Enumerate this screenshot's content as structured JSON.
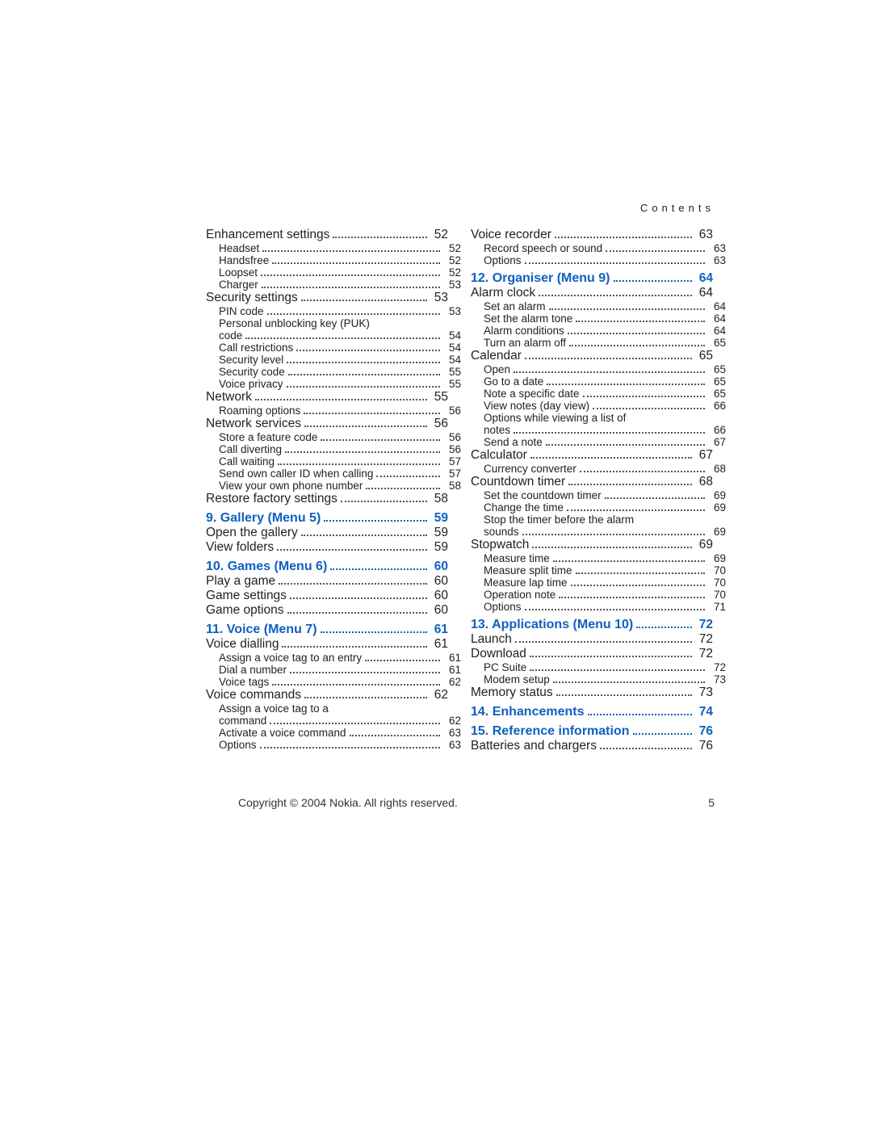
{
  "running_head": "Contents",
  "footer": {
    "copyright": "Copyright © 2004 Nokia. All rights reserved.",
    "page_number": "5"
  },
  "columns": [
    [
      {
        "level": 1,
        "label": "Enhancement settings",
        "page": "52"
      },
      {
        "level": 2,
        "label": "Headset",
        "page": "52"
      },
      {
        "level": 2,
        "label": "Handsfree",
        "page": "52"
      },
      {
        "level": 2,
        "label": "Loopset",
        "page": "52"
      },
      {
        "level": 2,
        "label": "Charger",
        "page": "53"
      },
      {
        "level": 1,
        "label": "Security settings",
        "page": "53"
      },
      {
        "level": 2,
        "label": "PIN code",
        "page": "53"
      },
      {
        "level": 2,
        "label": "Personal unblocking key (PUK) code",
        "page": "54",
        "wrap": "Personal unblocking key (PUK)|code"
      },
      {
        "level": 2,
        "label": "Call restrictions",
        "page": "54"
      },
      {
        "level": 2,
        "label": "Security level",
        "page": "54"
      },
      {
        "level": 2,
        "label": "Security code",
        "page": "55"
      },
      {
        "level": 2,
        "label": "Voice privacy",
        "page": "55"
      },
      {
        "level": 1,
        "label": "Network",
        "page": "55"
      },
      {
        "level": 2,
        "label": "Roaming options",
        "page": "56"
      },
      {
        "level": 1,
        "label": "Network services",
        "page": "56"
      },
      {
        "level": 2,
        "label": "Store a feature code",
        "page": "56"
      },
      {
        "level": 2,
        "label": "Call diverting",
        "page": "56"
      },
      {
        "level": 2,
        "label": "Call waiting",
        "page": "57"
      },
      {
        "level": 2,
        "label": "Send own caller ID when calling",
        "page": "57"
      },
      {
        "level": 2,
        "label": "View your own phone number",
        "page": "58"
      },
      {
        "level": 1,
        "label": "Restore factory settings",
        "page": "58"
      },
      {
        "level": 0,
        "label": "9. Gallery (Menu 5)",
        "page": "59"
      },
      {
        "level": 1,
        "label": "Open the gallery",
        "page": "59"
      },
      {
        "level": 1,
        "label": "View folders",
        "page": "59"
      },
      {
        "level": 0,
        "label": "10. Games (Menu 6)",
        "page": "60"
      },
      {
        "level": 1,
        "label": "Play a game",
        "page": "60"
      },
      {
        "level": 1,
        "label": "Game settings",
        "page": "60"
      },
      {
        "level": 1,
        "label": "Game options",
        "page": "60"
      },
      {
        "level": 0,
        "label": "11. Voice (Menu 7)",
        "page": "61"
      },
      {
        "level": 1,
        "label": "Voice dialling",
        "page": "61"
      },
      {
        "level": 2,
        "label": "Assign a voice tag to an entry",
        "page": "61"
      },
      {
        "level": 2,
        "label": "Dial a number",
        "page": "61"
      },
      {
        "level": 2,
        "label": "Voice tags",
        "page": "62"
      },
      {
        "level": 1,
        "label": "Voice commands",
        "page": "62"
      },
      {
        "level": 2,
        "label": "Assign a voice tag to a command",
        "page": "62",
        "wrap": "Assign a voice tag to a|command"
      },
      {
        "level": 2,
        "label": "Activate a voice command",
        "page": "63"
      },
      {
        "level": 2,
        "label": "Options",
        "page": "63"
      }
    ],
    [
      {
        "level": 1,
        "label": "Voice recorder",
        "page": "63"
      },
      {
        "level": 2,
        "label": "Record speech or sound",
        "page": "63"
      },
      {
        "level": 2,
        "label": "Options",
        "page": "63"
      },
      {
        "level": 0,
        "label": "12. Organiser (Menu 9)",
        "page": "64"
      },
      {
        "level": 1,
        "label": "Alarm clock",
        "page": "64"
      },
      {
        "level": 2,
        "label": "Set an alarm",
        "page": "64"
      },
      {
        "level": 2,
        "label": "Set the alarm tone",
        "page": "64"
      },
      {
        "level": 2,
        "label": "Alarm conditions",
        "page": "64"
      },
      {
        "level": 2,
        "label": "Turn an alarm off",
        "page": "65"
      },
      {
        "level": 1,
        "label": "Calendar",
        "page": "65"
      },
      {
        "level": 2,
        "label": "Open",
        "page": "65"
      },
      {
        "level": 2,
        "label": "Go to a date",
        "page": "65"
      },
      {
        "level": 2,
        "label": "Note a specific date",
        "page": "65"
      },
      {
        "level": 2,
        "label": "View notes (day view)",
        "page": "66"
      },
      {
        "level": 2,
        "label": "Options while viewing a list of notes",
        "page": "66",
        "wrap": "Options while viewing a list of|notes"
      },
      {
        "level": 2,
        "label": "Send a note",
        "page": "67"
      },
      {
        "level": 1,
        "label": "Calculator",
        "page": "67"
      },
      {
        "level": 2,
        "label": "Currency converter",
        "page": "68"
      },
      {
        "level": 1,
        "label": "Countdown timer",
        "page": "68"
      },
      {
        "level": 2,
        "label": "Set the countdown timer",
        "page": "69"
      },
      {
        "level": 2,
        "label": "Change the time",
        "page": "69"
      },
      {
        "level": 2,
        "label": "Stop the timer before the alarm sounds",
        "page": "69",
        "wrap": "Stop the timer before the alarm|sounds"
      },
      {
        "level": 1,
        "label": "Stopwatch",
        "page": "69"
      },
      {
        "level": 2,
        "label": "Measure time",
        "page": "69"
      },
      {
        "level": 2,
        "label": "Measure split time",
        "page": "70"
      },
      {
        "level": 2,
        "label": "Measure lap time",
        "page": "70"
      },
      {
        "level": 2,
        "label": "Operation note",
        "page": "70"
      },
      {
        "level": 2,
        "label": "Options",
        "page": "71"
      },
      {
        "level": 0,
        "label": "13. Applications (Menu 10)",
        "page": "72"
      },
      {
        "level": 1,
        "label": "Launch",
        "page": "72"
      },
      {
        "level": 1,
        "label": "Download",
        "page": "72"
      },
      {
        "level": 2,
        "label": "PC Suite",
        "page": "72"
      },
      {
        "level": 2,
        "label": "Modem setup",
        "page": "73"
      },
      {
        "level": 1,
        "label": "Memory status",
        "page": "73"
      },
      {
        "level": 0,
        "label": "14. Enhancements",
        "page": "74"
      },
      {
        "level": 0,
        "label": "15. Reference information",
        "page": "76"
      },
      {
        "level": 1,
        "label": "Batteries and chargers",
        "page": "76"
      }
    ]
  ]
}
